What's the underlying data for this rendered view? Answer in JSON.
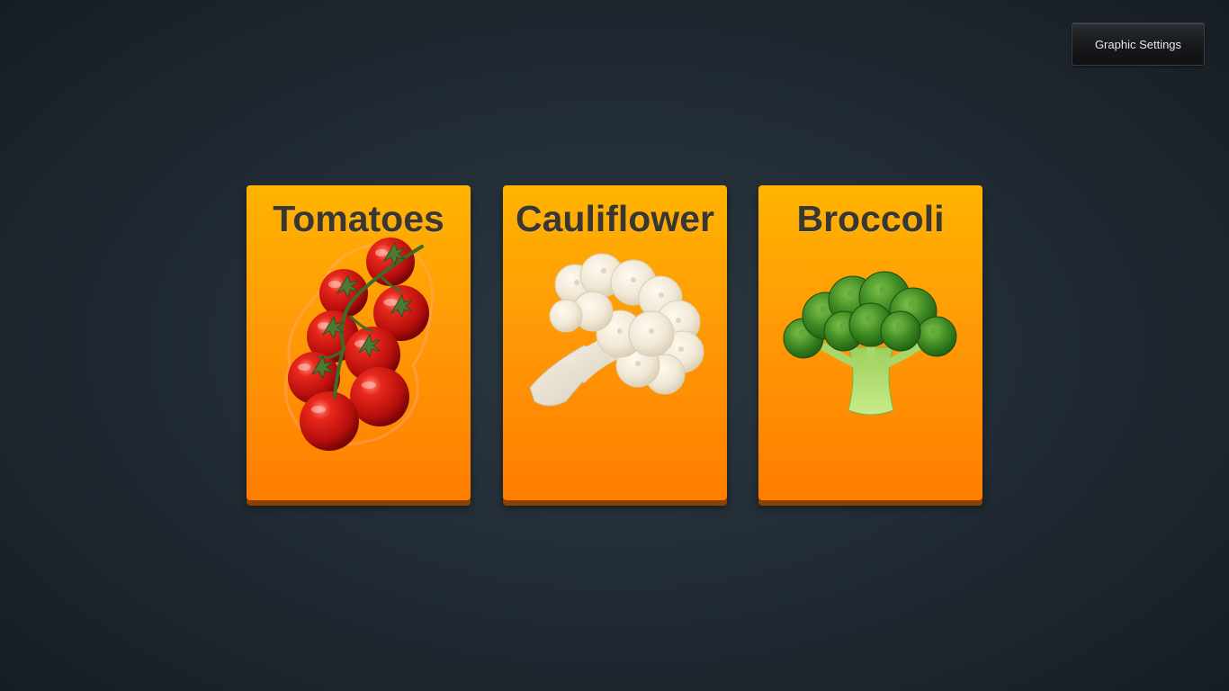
{
  "header": {
    "settings_button_label": "Graphic Settings"
  },
  "cards": [
    {
      "title": "Tomatoes",
      "image_icon": "tomato-bunch-image"
    },
    {
      "title": "Cauliflower",
      "image_icon": "cauliflower-image"
    },
    {
      "title": "Broccoli",
      "image_icon": "broccoli-image"
    }
  ],
  "colors": {
    "card_top": "#ffb400",
    "card_bottom": "#ff7d00",
    "title_text": "#3a3631",
    "background": "#222c35"
  }
}
